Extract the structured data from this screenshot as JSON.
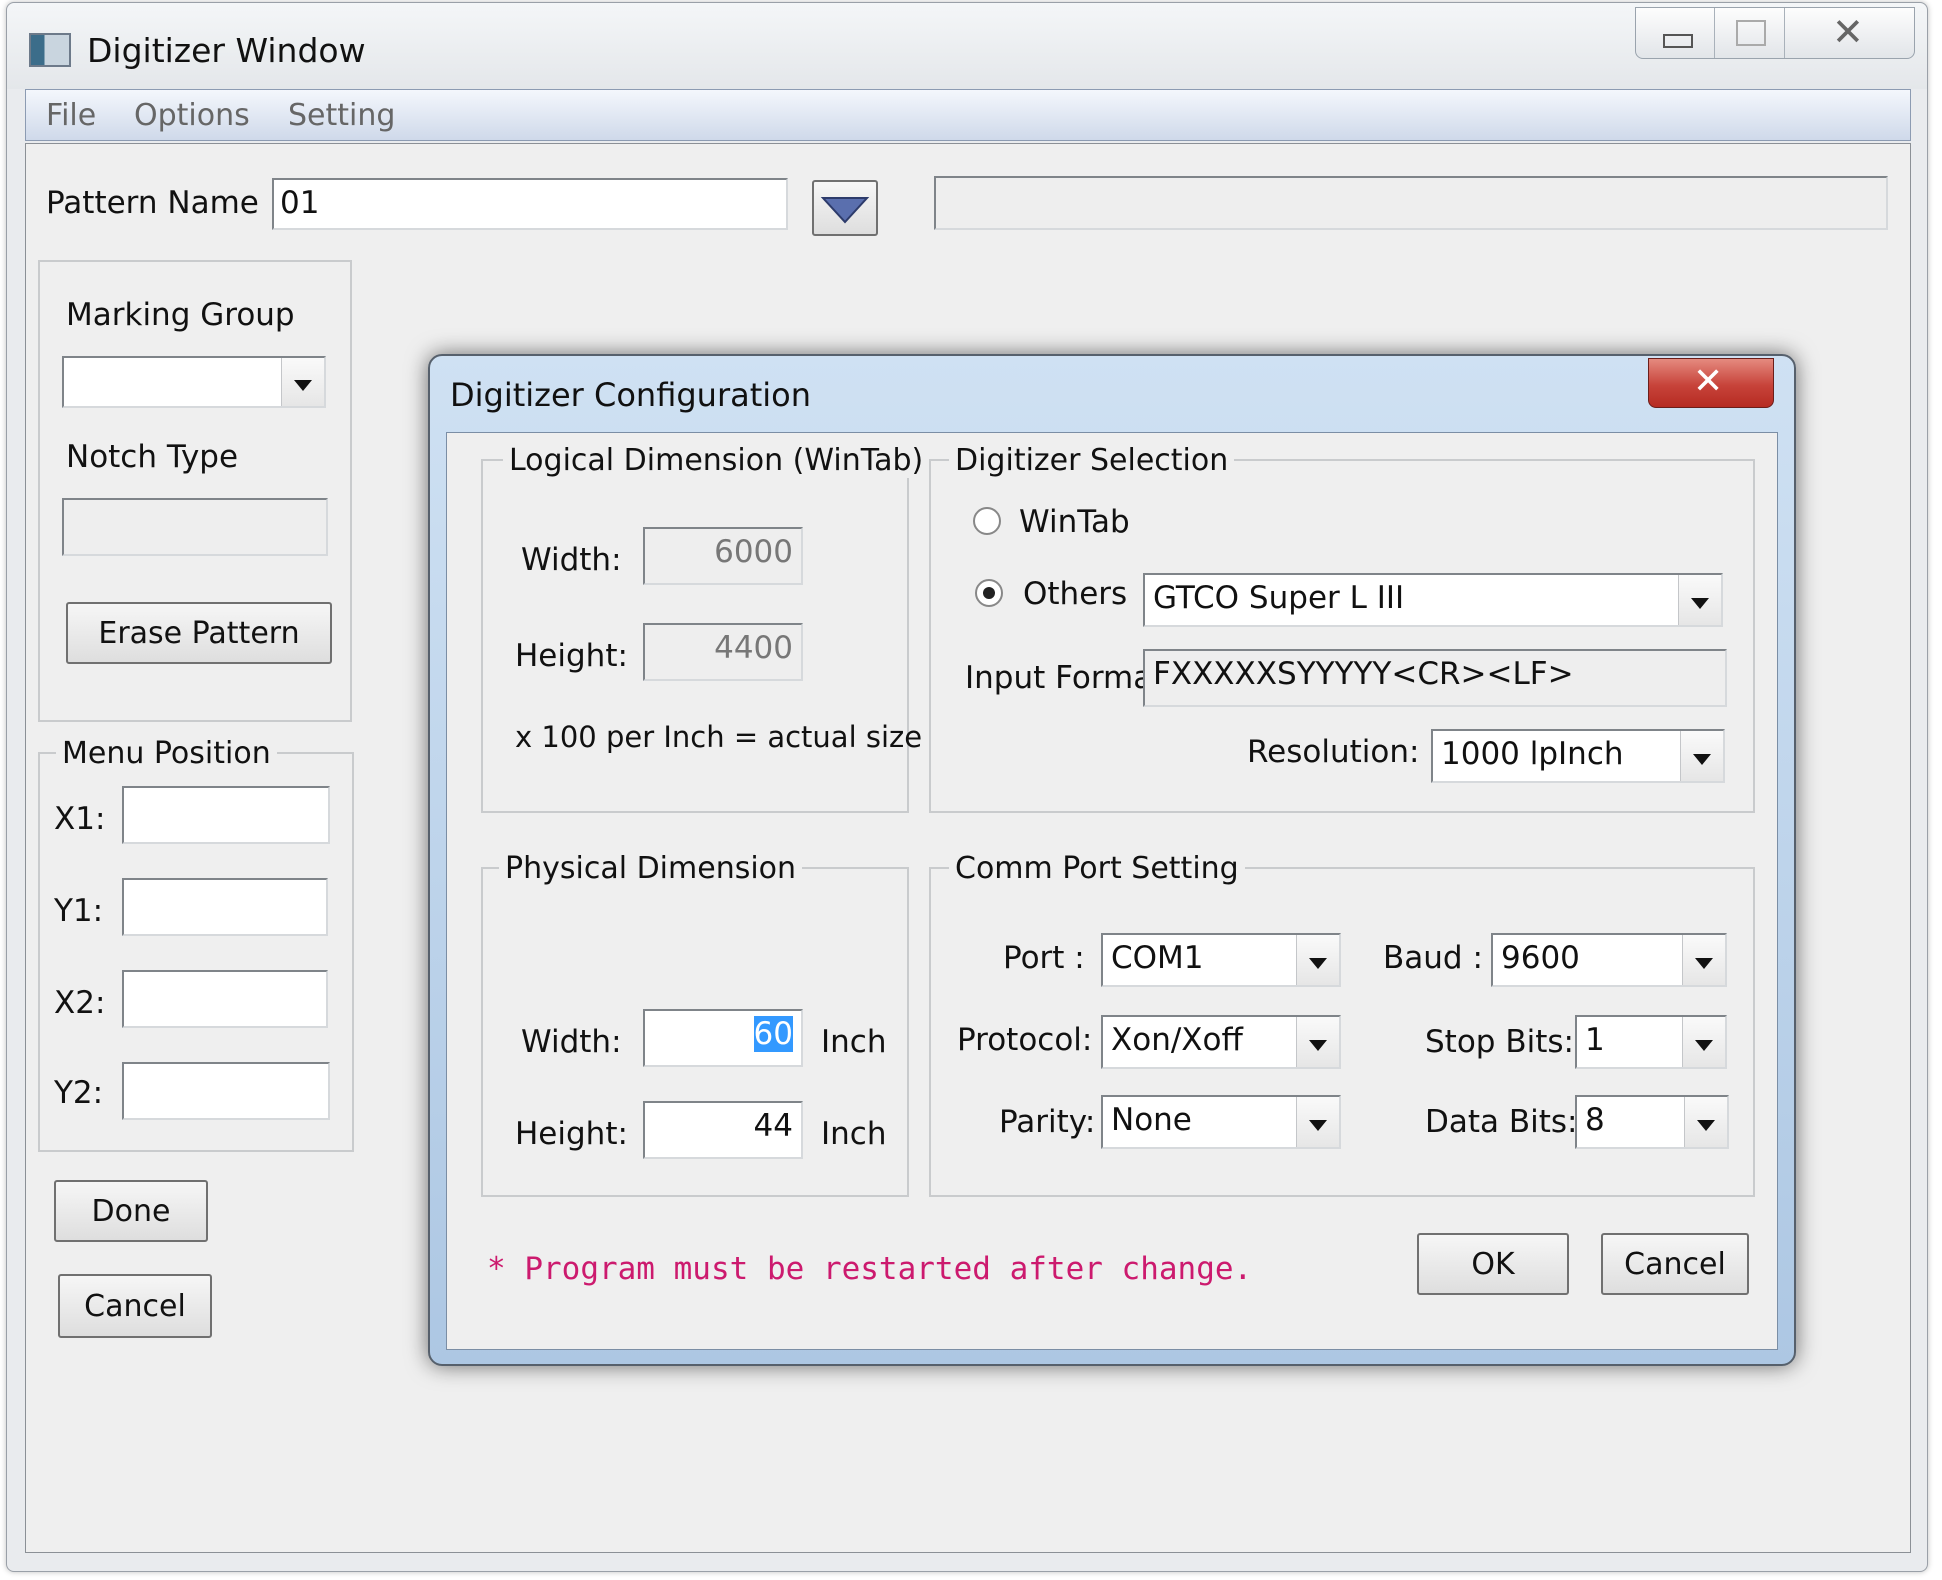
{
  "window": {
    "title": "Digitizer Window"
  },
  "menu": {
    "file": "File",
    "options": "Options",
    "setting": "Setting"
  },
  "pattern": {
    "label": "Pattern Name",
    "value": "01",
    "info": ""
  },
  "left_panel": {
    "marking_group_label": "Marking Group",
    "marking_group_value": "",
    "notch_type_label": "Notch Type",
    "notch_type_value": "",
    "erase_button": "Erase Pattern",
    "menu_position_label": "Menu Position",
    "x1_label": "X1:",
    "y1_label": "Y1:",
    "x2_label": "X2:",
    "y2_label": "Y2:",
    "x1_value": "",
    "y1_value": "",
    "x2_value": "",
    "y2_value": "",
    "done_button": "Done",
    "cancel_button": "Cancel"
  },
  "dialog": {
    "title": "Digitizer Configuration",
    "logical": {
      "legend": "Logical Dimension (WinTab)",
      "width_label": "Width:",
      "width_value": "6000",
      "height_label": "Height:",
      "height_value": "4400",
      "note": "x 100 per Inch = actual size"
    },
    "selection": {
      "legend": "Digitizer Selection",
      "wintab_label": "WinTab",
      "others_label": "Others",
      "others_value": "GTCO Super L III",
      "input_format_label": "Input Format:",
      "input_format_value": "FXXXXXSYYYYY<CR><LF>",
      "resolution_label": "Resolution:",
      "resolution_value": "1000 lpInch"
    },
    "physical": {
      "legend": "Physical Dimension",
      "width_label": "Width:",
      "width_value": "60",
      "width_unit": "Inch",
      "height_label": "Height:",
      "height_value": "44",
      "height_unit": "Inch"
    },
    "comm": {
      "legend": "Comm Port Setting",
      "port_label": "Port :",
      "port_value": "COM1",
      "baud_label": "Baud :",
      "baud_value": "9600",
      "protocol_label": "Protocol:",
      "protocol_value": "Xon/Xoff",
      "stop_bits_label": "Stop Bits:",
      "stop_bits_value": "1",
      "parity_label": "Parity:",
      "parity_value": "None",
      "data_bits_label": "Data Bits:",
      "data_bits_value": "8"
    },
    "note": "* Program must be restarted after change.",
    "ok_button": "OK",
    "cancel_button": "Cancel"
  }
}
